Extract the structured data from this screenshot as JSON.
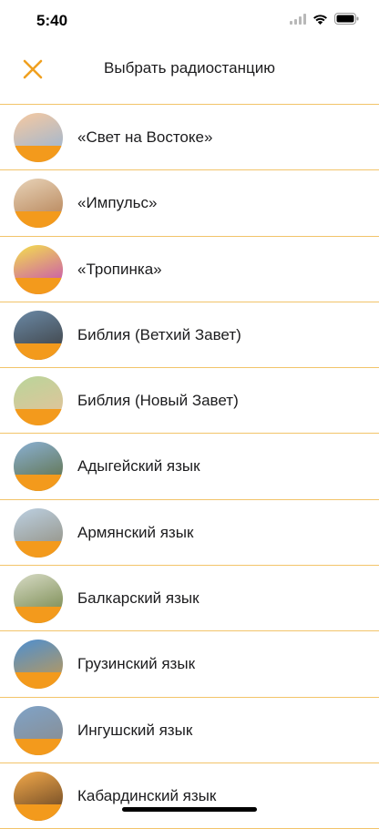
{
  "status_bar": {
    "time": "5:40"
  },
  "nav": {
    "title": "Выбрать радиостанцию",
    "close_icon": "close-icon",
    "accent_color": "#f0a020"
  },
  "divider_color": "#f2c46a",
  "stations": [
    {
      "label": "«Свет на Востоке»",
      "name": "svet-na-vostoke",
      "colors": [
        "#f7c9a0",
        "#8fb3d9"
      ]
    },
    {
      "label": "«Импульс»",
      "name": "impuls",
      "colors": [
        "#e8d3b8",
        "#b07a4c"
      ]
    },
    {
      "label": "«Тропинка»",
      "name": "tropinka",
      "colors": [
        "#f4e04d",
        "#c13fbf"
      ]
    },
    {
      "label": "Библия (Ветхий Завет)",
      "name": "bibliya-vethiy-zavet",
      "colors": [
        "#6a89a6",
        "#3a3a3a"
      ]
    },
    {
      "label": "Библия (Новый Завет)",
      "name": "bibliya-novyy-zavet",
      "colors": [
        "#b9d59a",
        "#e8c09a"
      ]
    },
    {
      "label": "Адыгейский язык",
      "name": "adygeyskiy-yazyk",
      "colors": [
        "#8ab0d3",
        "#5b6b3a"
      ]
    },
    {
      "label": "Армянский язык",
      "name": "armyanskiy-yazyk",
      "colors": [
        "#bcd0e2",
        "#8f8a78"
      ]
    },
    {
      "label": "Балкарский язык",
      "name": "balkarskiy-yazyk",
      "colors": [
        "#d7dbc5",
        "#6b7e3f"
      ]
    },
    {
      "label": "Грузинский язык",
      "name": "gruzinskiy-yazyk",
      "colors": [
        "#4d8fd1",
        "#c99a4a"
      ]
    },
    {
      "label": "Ингушский язык",
      "name": "ingushskiy-yazyk",
      "colors": [
        "#7fa3c8",
        "#8a8a8a"
      ]
    },
    {
      "label": "Кабардинский язык",
      "name": "kabardinskiy-yazyk",
      "colors": [
        "#f3a94a",
        "#5a3b20"
      ]
    }
  ]
}
